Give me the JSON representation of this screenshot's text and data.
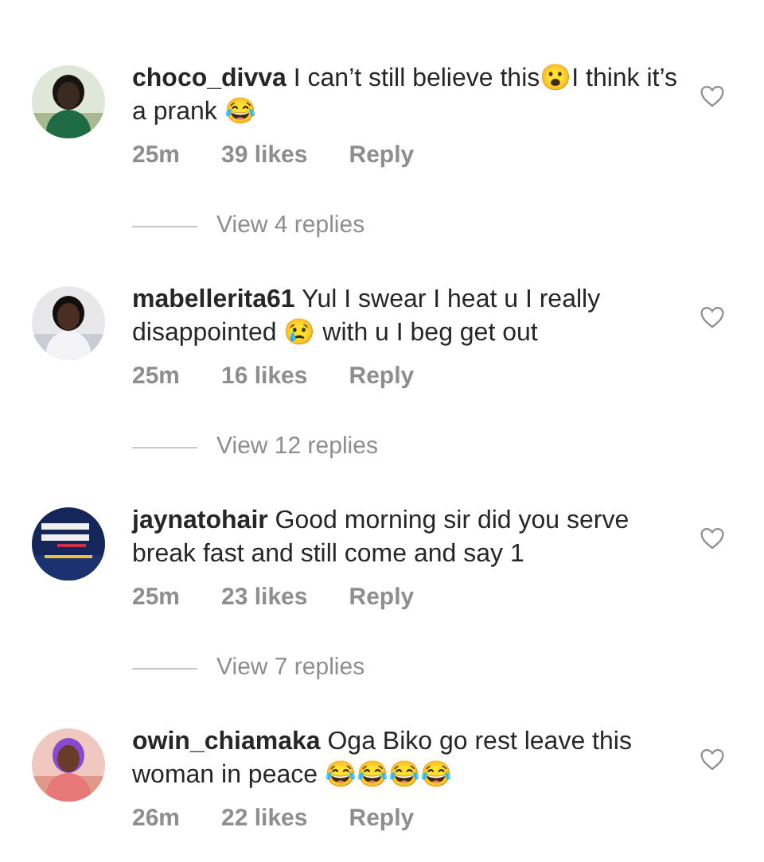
{
  "comments": [
    {
      "username": "choco_divva",
      "text": "I can’t still believe this😮I think it’s a prank 😂",
      "time": "25m",
      "likes": "39 likes",
      "reply": "Reply",
      "liked": false,
      "view_replies": "View 4 replies"
    },
    {
      "username": "mabellerita61",
      "text": "Yul I swear I heat u I really disappointed 😢 with u I beg get out",
      "time": "25m",
      "likes": "16 likes",
      "reply": "Reply",
      "liked": false,
      "view_replies": "View 12 replies"
    },
    {
      "username": "jaynatohair",
      "text": "Good morning sir did you serve break fast and still come and say 1",
      "time": "25m",
      "likes": "23 likes",
      "reply": "Reply",
      "liked": false,
      "view_replies": "View 7 replies"
    },
    {
      "username": "owin_chiamaka",
      "text": "Oga Biko go rest leave this woman in peace 😂😂😂😂",
      "time": "26m",
      "likes": "22 likes",
      "reply": "Reply",
      "liked": false
    }
  ]
}
